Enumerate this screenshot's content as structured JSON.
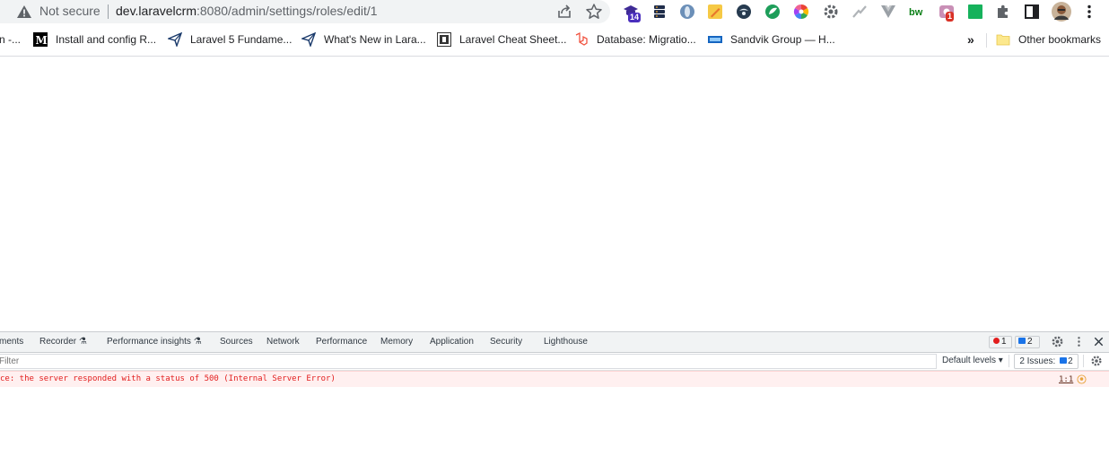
{
  "omnibox": {
    "security_label": "Not secure",
    "url_host": "dev.laravelcrm",
    "url_rest": ":8080/admin/settings/roles/edit/1"
  },
  "extensions": [
    {
      "name": "extension-1",
      "badge": "14",
      "badge_color": "#4a2fbd"
    },
    {
      "name": "extension-10",
      "badge": "1",
      "badge_color": "#d93025"
    }
  ],
  "bookmarks": [
    {
      "label": "n -..."
    },
    {
      "label": "Install and config R..."
    },
    {
      "label": "Laravel 5 Fundame..."
    },
    {
      "label": "What's New in Lara..."
    },
    {
      "label": "Laravel Cheat Sheet..."
    },
    {
      "label": "Database: Migratio..."
    },
    {
      "label": "Sandvik Group — H..."
    }
  ],
  "bookmarks_overflow": "»",
  "other_bookmarks": "Other bookmarks",
  "devtools": {
    "tabs": [
      "ments",
      "Recorder",
      "Performance insights",
      "Sources",
      "Network",
      "Performance",
      "Memory",
      "Application",
      "Security",
      "Lighthouse"
    ],
    "error_count": "1",
    "issue_count": "2",
    "filter_placeholder": "Filter",
    "default_levels": "Default levels ▾",
    "issues_label": "2 Issues:",
    "issues_count": "2",
    "error_message": "ce: the server responded with a status of 500 (Internal Server Error)",
    "error_source": "1:1"
  },
  "colors": {
    "error_red": "#e21d1d",
    "error_bg": "#fff0f0",
    "issue_blue": "#1a73e8"
  }
}
